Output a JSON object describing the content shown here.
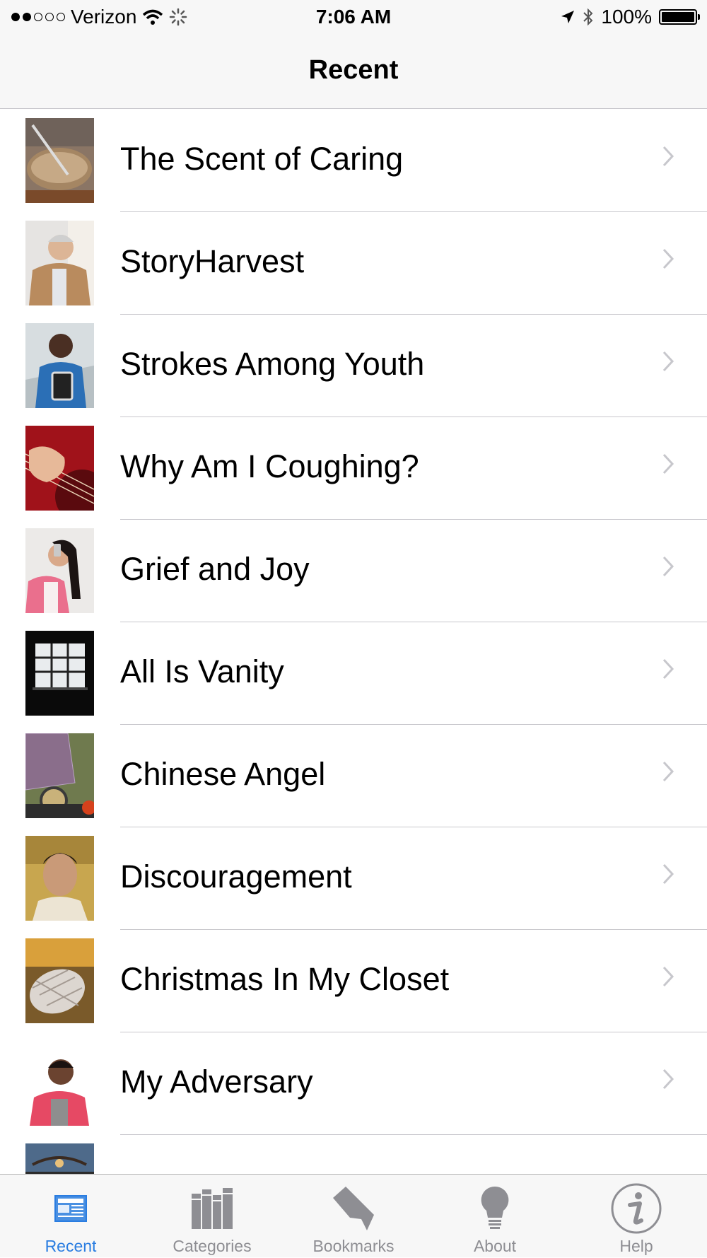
{
  "status_bar": {
    "carrier": "Verizon",
    "time": "7:06 AM",
    "battery": "100%"
  },
  "nav": {
    "title": "Recent"
  },
  "items": [
    {
      "title": "The Scent of Caring"
    },
    {
      "title": "StoryHarvest"
    },
    {
      "title": "Strokes Among Youth"
    },
    {
      "title": "Why Am I Coughing?"
    },
    {
      "title": "Grief and Joy"
    },
    {
      "title": "All Is Vanity"
    },
    {
      "title": "Chinese Angel"
    },
    {
      "title": "Discouragement"
    },
    {
      "title": "Christmas In My Closet"
    },
    {
      "title": "My Adversary"
    },
    {
      "title": ""
    }
  ],
  "tabs": [
    {
      "label": "Recent",
      "icon": "newspaper-icon",
      "active": true
    },
    {
      "label": "Categories",
      "icon": "books-icon"
    },
    {
      "label": "Bookmarks",
      "icon": "bookmark-icon"
    },
    {
      "label": "About",
      "icon": "lightbulb-icon"
    },
    {
      "label": "Help",
      "icon": "info-icon"
    }
  ],
  "colors": {
    "accent": "#2a7de1",
    "inactive": "#8e8e93",
    "separator": "#c8c7cc"
  }
}
